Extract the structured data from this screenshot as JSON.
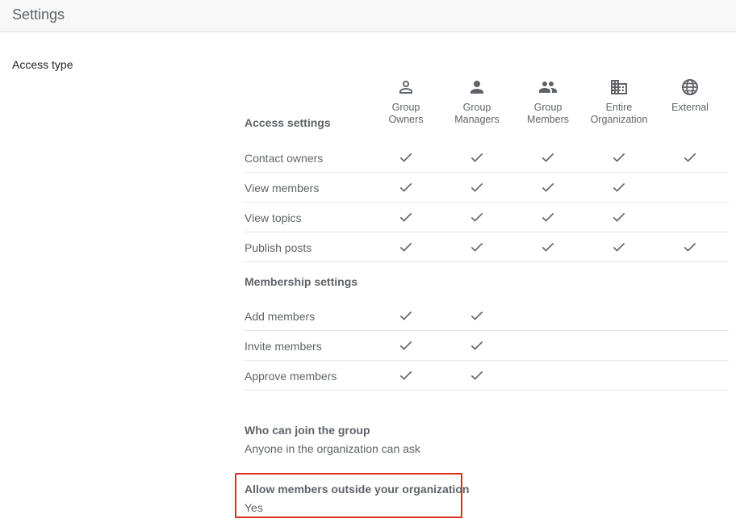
{
  "header": {
    "title": "Settings"
  },
  "section_label": "Access type",
  "columns": [
    {
      "label": "Group\nOwners",
      "icon": "person-outline-icon"
    },
    {
      "label": "Group\nManagers",
      "icon": "person-icon"
    },
    {
      "label": "Group\nMembers",
      "icon": "people-icon"
    },
    {
      "label": "Entire\nOrganization",
      "icon": "building-icon"
    },
    {
      "label": "External",
      "icon": "globe-icon"
    }
  ],
  "access_settings": {
    "title": "Access settings",
    "rows": [
      {
        "label": "Contact owners",
        "checks": [
          true,
          true,
          true,
          true,
          true
        ]
      },
      {
        "label": "View members",
        "checks": [
          true,
          true,
          true,
          true,
          false
        ]
      },
      {
        "label": "View topics",
        "checks": [
          true,
          true,
          true,
          true,
          false
        ]
      },
      {
        "label": "Publish posts",
        "checks": [
          true,
          true,
          true,
          true,
          true
        ]
      }
    ]
  },
  "membership_settings": {
    "title": "Membership settings",
    "rows": [
      {
        "label": "Add members",
        "checks": [
          true,
          true,
          false,
          false,
          false
        ]
      },
      {
        "label": "Invite members",
        "checks": [
          true,
          true,
          false,
          false,
          false
        ]
      },
      {
        "label": "Approve members",
        "checks": [
          true,
          true,
          false,
          false,
          false
        ]
      }
    ]
  },
  "who_can_join": {
    "question": "Who can join the group",
    "answer": "Anyone in the organization can ask"
  },
  "allow_external": {
    "question": "Allow members outside your organization",
    "answer": "Yes"
  },
  "colors": {
    "check": "#5f6368",
    "highlight_border": "#d93025",
    "text_muted": "#5f6368"
  }
}
